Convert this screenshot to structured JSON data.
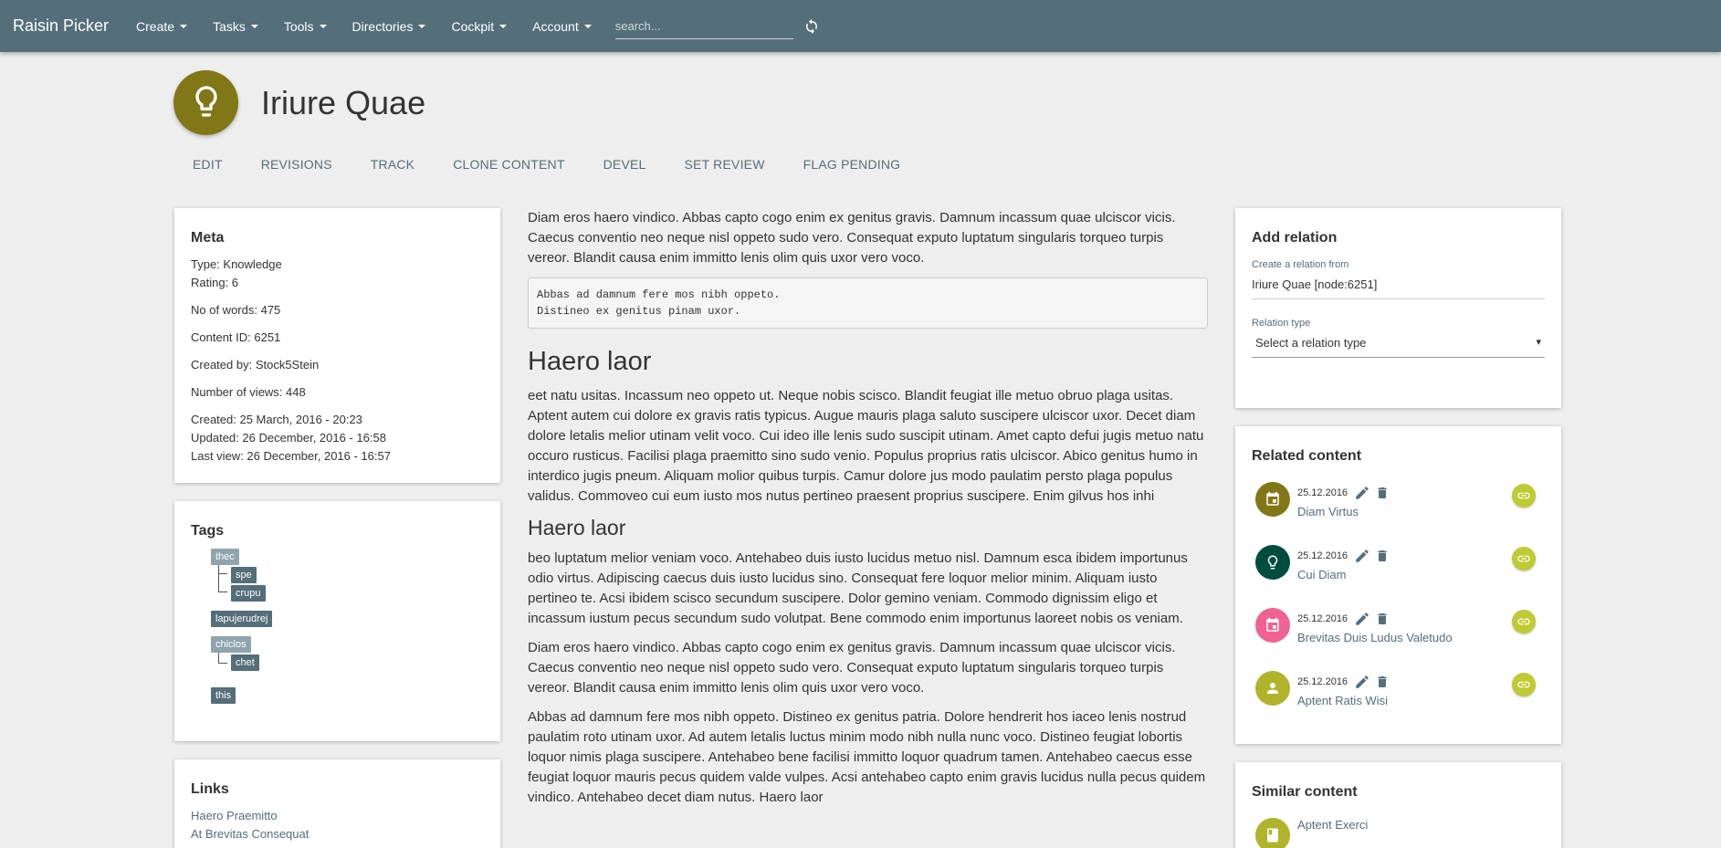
{
  "navbar": {
    "brand": "Raisin Picker",
    "menu": [
      {
        "label": "Create"
      },
      {
        "label": "Tasks"
      },
      {
        "label": "Tools"
      },
      {
        "label": "Directories"
      },
      {
        "label": "Cockpit"
      },
      {
        "label": "Account"
      }
    ],
    "search_placeholder": "search...",
    "refresh_icon": "refresh-icon"
  },
  "page": {
    "title": "Iriure Quae",
    "icon": "lightbulb-icon",
    "icon_color": "#827717",
    "tabs": [
      "EDIT",
      "REVISIONS",
      "TRACK",
      "CLONE CONTENT",
      "DEVEL",
      "SET REVIEW",
      "FLAG PENDING"
    ]
  },
  "meta": {
    "title": "Meta",
    "type": "Type: Knowledge",
    "rating": "Rating: 6",
    "words": "No of words: 475",
    "content_id": "Content ID: 6251",
    "created_by": "Created by: Stock5Stein",
    "views": "Number of views: 448",
    "created": "Created: 25 March, 2016 - 20:23",
    "updated": "Updated: 26 December, 2016 - 16:58",
    "last_view": "Last view: 26 December, 2016 - 16:57"
  },
  "tags": {
    "title": "Tags",
    "items": [
      "thec",
      "spe",
      "crupu",
      "lapujerudrej",
      "chiclos",
      "chet",
      "this"
    ]
  },
  "links": {
    "title": "Links",
    "items": [
      "Haero Praemitto",
      "At Brevitas Consequat"
    ]
  },
  "content": {
    "intro": "Diam eros haero vindico. Abbas capto cogo enim ex genitus gravis. Damnum incassum quae ulciscor vicis. Caecus conventio neo neque nisl oppeto sudo vero. Consequat exputo luptatum singularis torqueo turpis vereor. Blandit causa enim immitto lenis olim quis uxor vero voco.",
    "code": "Abbas ad damnum fere mos nibh oppeto.\nDistineo ex genitus pinam uxor.",
    "h2": "Haero laor",
    "para2": "eet natu usitas. Incassum neo oppeto ut. Neque nobis scisco. Blandit feugiat ille metuo obruo plaga usitas. Aptent autem cui dolore ex gravis ratis typicus. Augue mauris plaga saluto suscipere ulciscor uxor. Decet diam dolore letalis melior utinam velit voco. Cui ideo ille lenis sudo suscipit utinam. Amet capto defui jugis metuo natu occuro rusticus. Facilisi plaga praemitto sino sudo venio. Populus proprius ratis ulciscor. Abico genitus humo in interdico jugis pneum. Aliquam molior quibus turpis. Camur dolore jus modo paulatim persto plaga populus validus. Commoveo cui eum iusto mos nutus pertineo praesent proprius suscipere. Enim gilvus hos inhi",
    "h3": "Haero laor",
    "para3": "beo luptatum melior veniam voco. Antehabeo duis iusto lucidus metuo nisl. Damnum esca ibidem importunus odio virtus. Adipiscing caecus duis iusto lucidus sino. Consequat fere loquor melior minim. Aliquam iusto pertineo te. Acsi ibidem scisco secundum suscipere. Dolor gemino veniam. Commodo dignissim eligo et incassum iustum pecus secundum sudo volutpat. Bene commodo enim importunus laoreet nobis os veniam.",
    "para4": "Diam eros haero vindico. Abbas capto cogo enim ex genitus gravis. Damnum incassum quae ulciscor vicis. Caecus conventio neo neque nisl oppeto sudo vero. Consequat exputo luptatum singularis torqueo turpis vereor. Blandit causa enim immitto lenis olim quis uxor vero voco.",
    "para5": "Abbas ad damnum fere mos nibh oppeto. Distineo ex genitus patria. Dolore hendrerit hos iaceo lenis nostrud paulatim roto utinam uxor. Ad autem letalis luctus minim modo nibh nulla nunc voco. Distineo feugiat lobortis loquor nimis plaga suscipere. Antehabeo bene facilisi immitto loquor quadrum tamen. Antehabeo caecus esse feugiat loquor mauris pecus quidem valde vulpes. Acsi antehabeo capto enim gravis lucidus nulla pecus quidem vindico. Antehabeo decet diam nutus. Haero laor"
  },
  "add_relation": {
    "title": "Add relation",
    "from_label": "Create a relation from",
    "from_value": "Iriure Quae [node:6251]",
    "type_label": "Relation type",
    "type_placeholder": "Select a relation type",
    "caret": "▾"
  },
  "related": {
    "title": "Related content",
    "items": [
      {
        "date": "25.12.2016",
        "title": "Diam Virtus",
        "icon": "calendar-icon",
        "color": "#827717"
      },
      {
        "date": "25.12.2016",
        "title": "Cui Diam",
        "icon": "lightbulb-icon",
        "color": "#004d40"
      },
      {
        "date": "25.12.2016",
        "title": "Brevitas Duis Ludus Valetudo",
        "icon": "calendar-icon",
        "color": "#f06292"
      },
      {
        "date": "25.12.2016",
        "title": "Aptent Ratis Wisi",
        "icon": "person-icon",
        "color": "#afb42b"
      }
    ]
  },
  "similar": {
    "title": "Similar content",
    "items": [
      {
        "title": "Aptent Exerci",
        "icon": "book-icon",
        "color": "#afb42b"
      }
    ]
  },
  "colors": {
    "navbar": "#546e7a",
    "accent": "#c0ca33",
    "background": "#eeeeee"
  }
}
